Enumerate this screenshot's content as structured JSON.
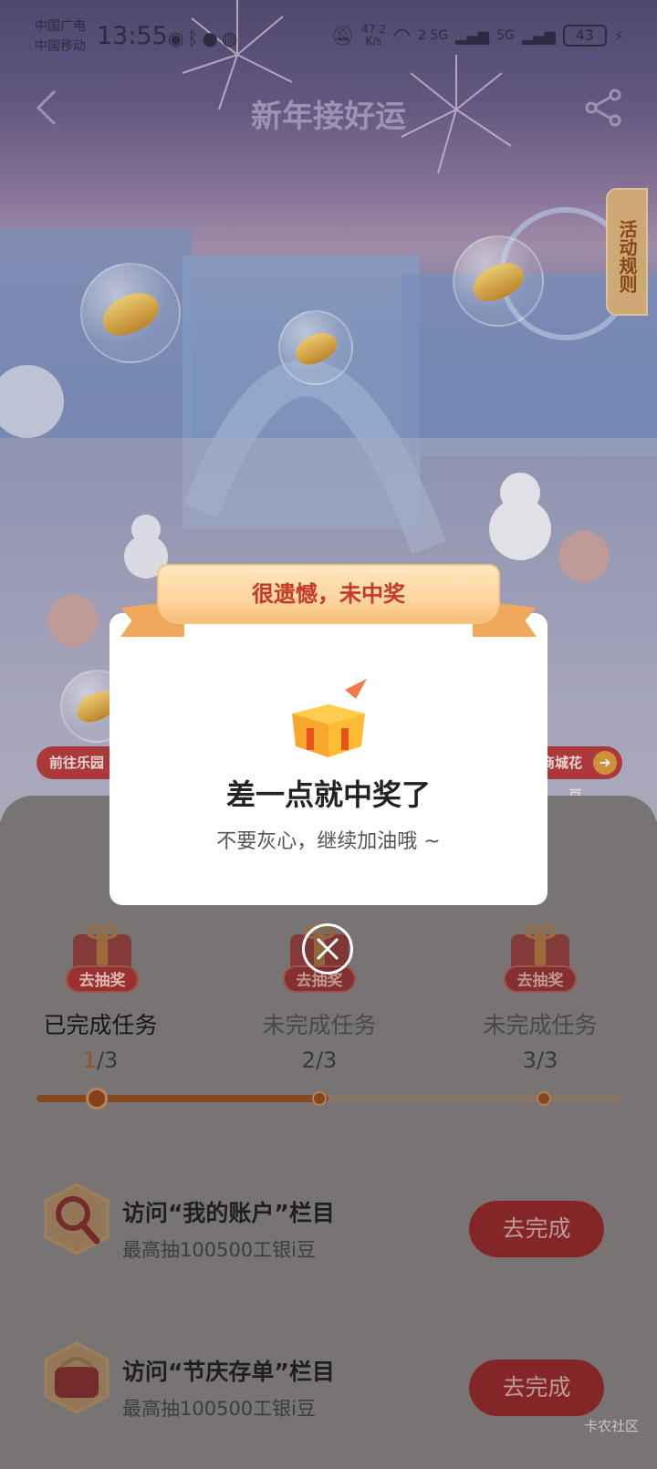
{
  "statusbar": {
    "carrier1": "中国广电",
    "carrier2": "中国移动",
    "time": "13:55",
    "net_speed_value": "47.2",
    "net_speed_unit": "K/s",
    "sig1": "2 5G",
    "sig2": "5G",
    "battery": "43"
  },
  "navbar": {
    "title": "新年接好运"
  },
  "hero": {
    "rules_tab": "活动规则",
    "left_pill": "前往乐园",
    "right_pill": "商城花豆"
  },
  "modal": {
    "ribbon_text": "很遗憾，未中奖",
    "title": "差一点就中奖了",
    "subtitle": "不要灰心，继续加油哦 ~"
  },
  "milestones": [
    {
      "tag": "去抽奖",
      "label": "已完成任务",
      "current": "1",
      "total": "/3"
    },
    {
      "tag": "去抽奖",
      "label": "未完成任务",
      "current": "2",
      "total": "/3"
    },
    {
      "tag": "去抽奖",
      "label": "未完成任务",
      "current": "3",
      "total": "/3"
    }
  ],
  "progress": {
    "fraction": 0.5
  },
  "tasks": [
    {
      "title": "访问“我的账户”栏目",
      "subtitle": "最高抽100500工银i豆",
      "button": "去完成",
      "icon": "magnifier-icon"
    },
    {
      "title": "访问“节庆存单”栏目",
      "subtitle": "最高抽100500工银i豆",
      "button": "去完成",
      "icon": "wallet-icon"
    }
  ],
  "watermark": "卡农社区",
  "colors": {
    "accent_red": "#c63a25",
    "button_red": "#8a2527",
    "ribbon_gold": "#ffd59d",
    "progress_brown": "#8a4b1c"
  }
}
